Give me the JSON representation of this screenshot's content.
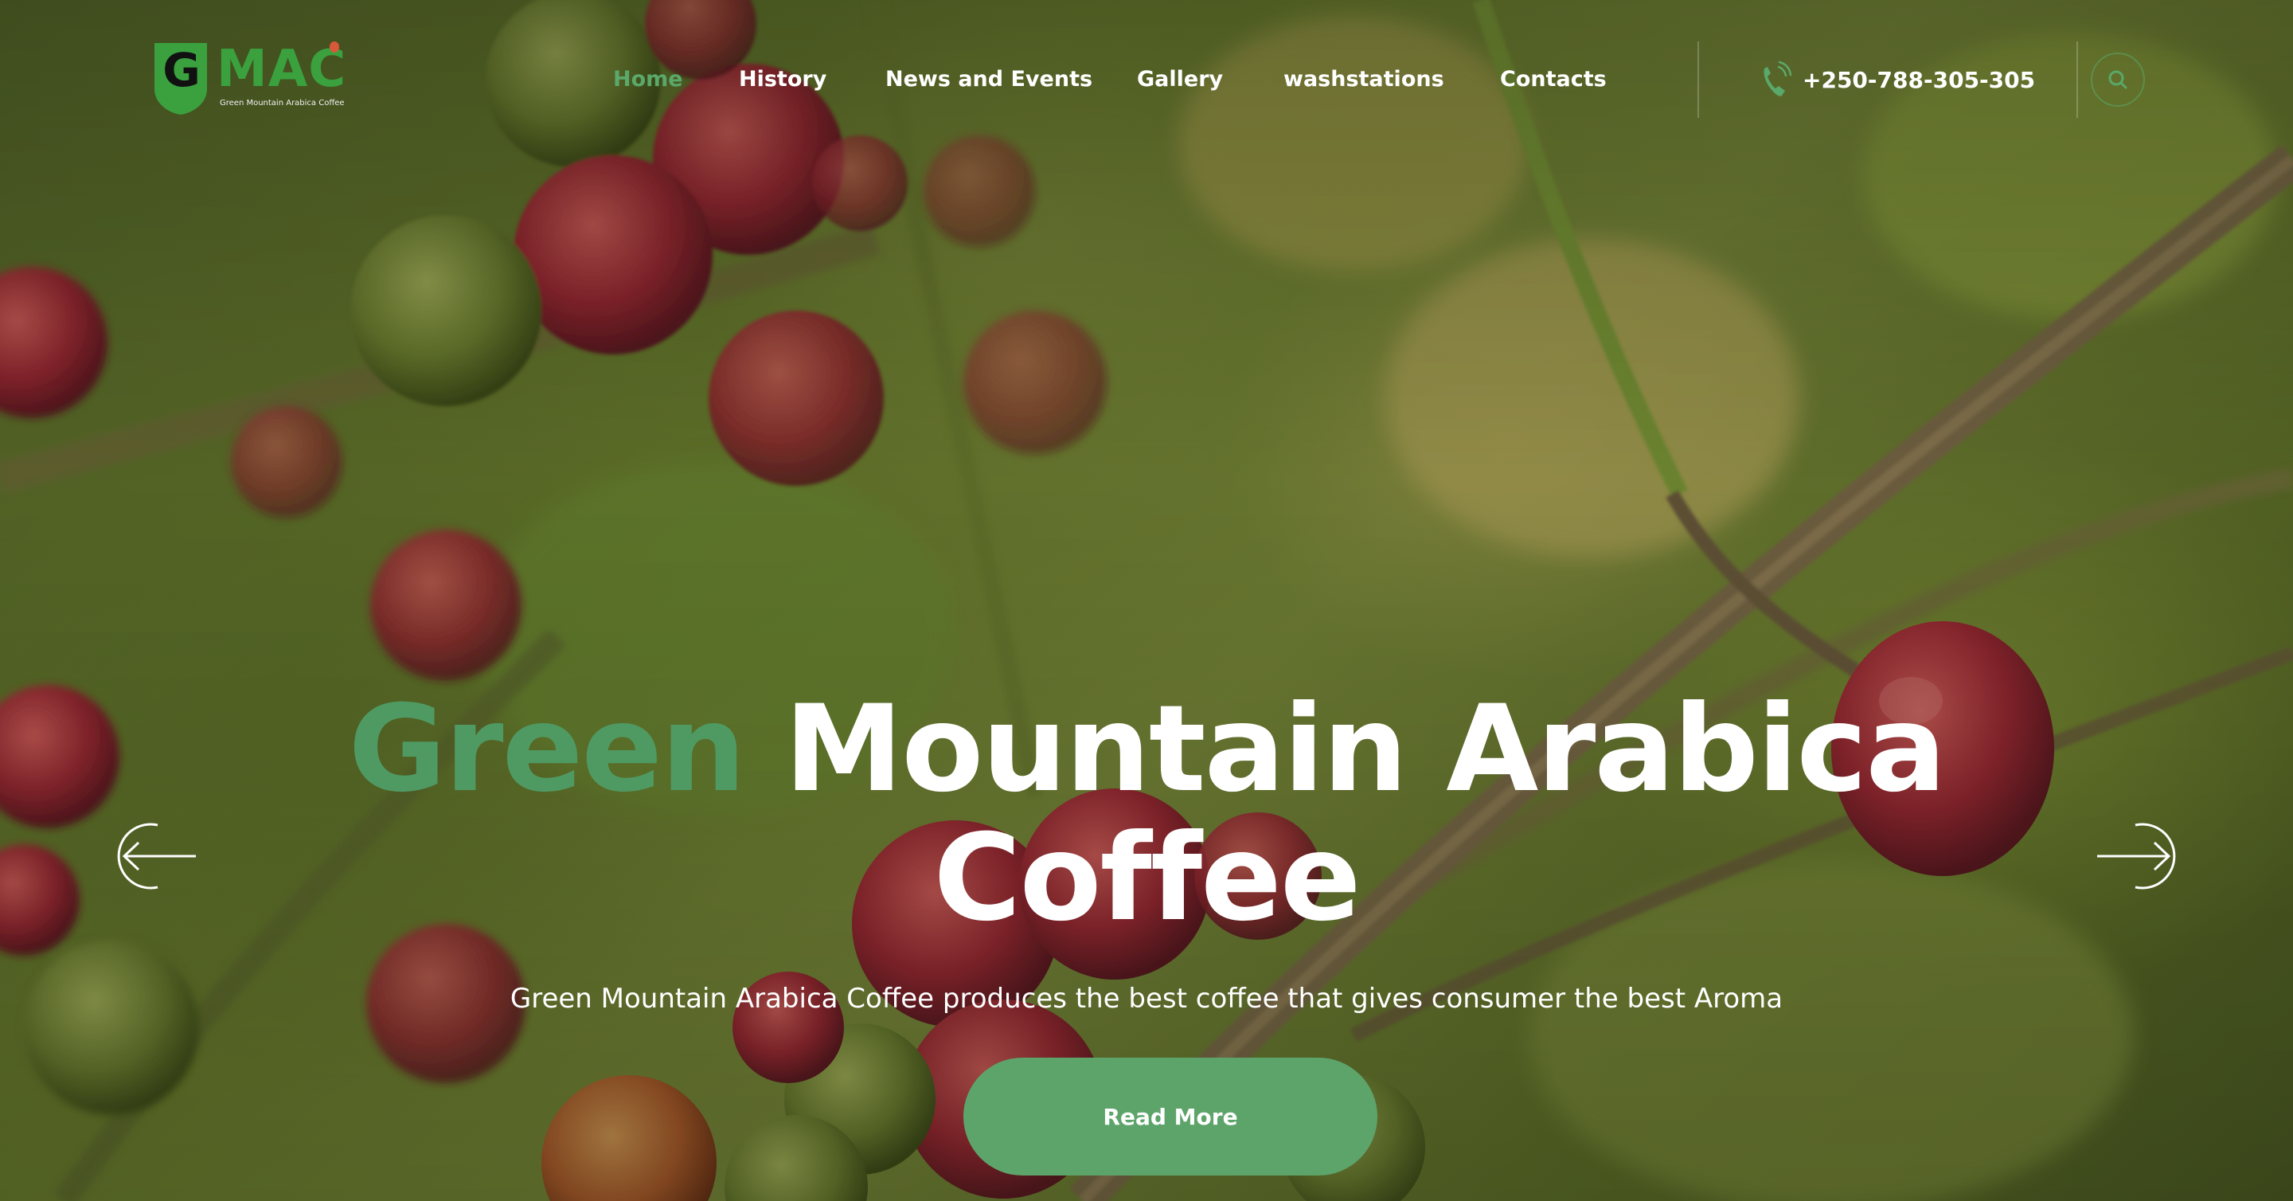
{
  "brand": {
    "logo_letter": "G",
    "logo_text": "MAC",
    "tagline": "Green Mountain Arabica Coffee",
    "colors": {
      "accent": "#5aa86a",
      "logo_green": "#3aa13e",
      "cta": "#5da46b"
    }
  },
  "nav": {
    "items": [
      {
        "label": "Home",
        "active": true
      },
      {
        "label": "History",
        "active": false
      },
      {
        "label": "News and Events",
        "active": false
      },
      {
        "label": "Gallery",
        "active": false
      },
      {
        "label": "washstations",
        "active": false
      },
      {
        "label": "Contacts",
        "active": false
      }
    ]
  },
  "contact": {
    "phone": "+250-788-305-305",
    "phone_icon": "phone-icon"
  },
  "search": {
    "icon": "search-icon"
  },
  "hero": {
    "headline_accent": "Green",
    "headline_rest": " Mountain Arabica",
    "headline_line2": "Coffee",
    "subtitle": "Green Mountain Arabica Coffee produces the best coffee that gives consumer the best Aroma",
    "cta_label": "Read More",
    "prev_icon": "arrow-left-icon",
    "next_icon": "arrow-right-icon"
  }
}
